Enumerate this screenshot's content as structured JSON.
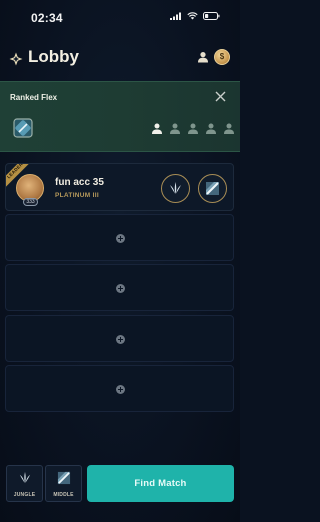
{
  "status_bar": {
    "time": "02:34"
  },
  "header": {
    "title": "Lobby",
    "currency_symbol": "$"
  },
  "queue": {
    "name": "Ranked Flex",
    "party_size": 5,
    "party_filled": 1
  },
  "leader": {
    "ribbon_label": "LEADER",
    "name": "fun acc 35",
    "rank": "PLATINUM III",
    "level": "333",
    "badge_text": "20"
  },
  "empty_slot_count": 4,
  "footer": {
    "primary_role": "JUNGLE",
    "secondary_role": "MIDDLE",
    "find_match_label": "Find Match"
  },
  "colors": {
    "accent": "#1fb3aa",
    "gold": "#a88d55",
    "banner": "#1e3c33",
    "background": "#0a1220"
  },
  "icons": {
    "brand": "brand-icon",
    "friends": "friends-icon",
    "currency": "currency-icon",
    "close": "close-icon",
    "jungle": "jungle-icon",
    "middle": "middle-icon",
    "add": "add-icon"
  }
}
